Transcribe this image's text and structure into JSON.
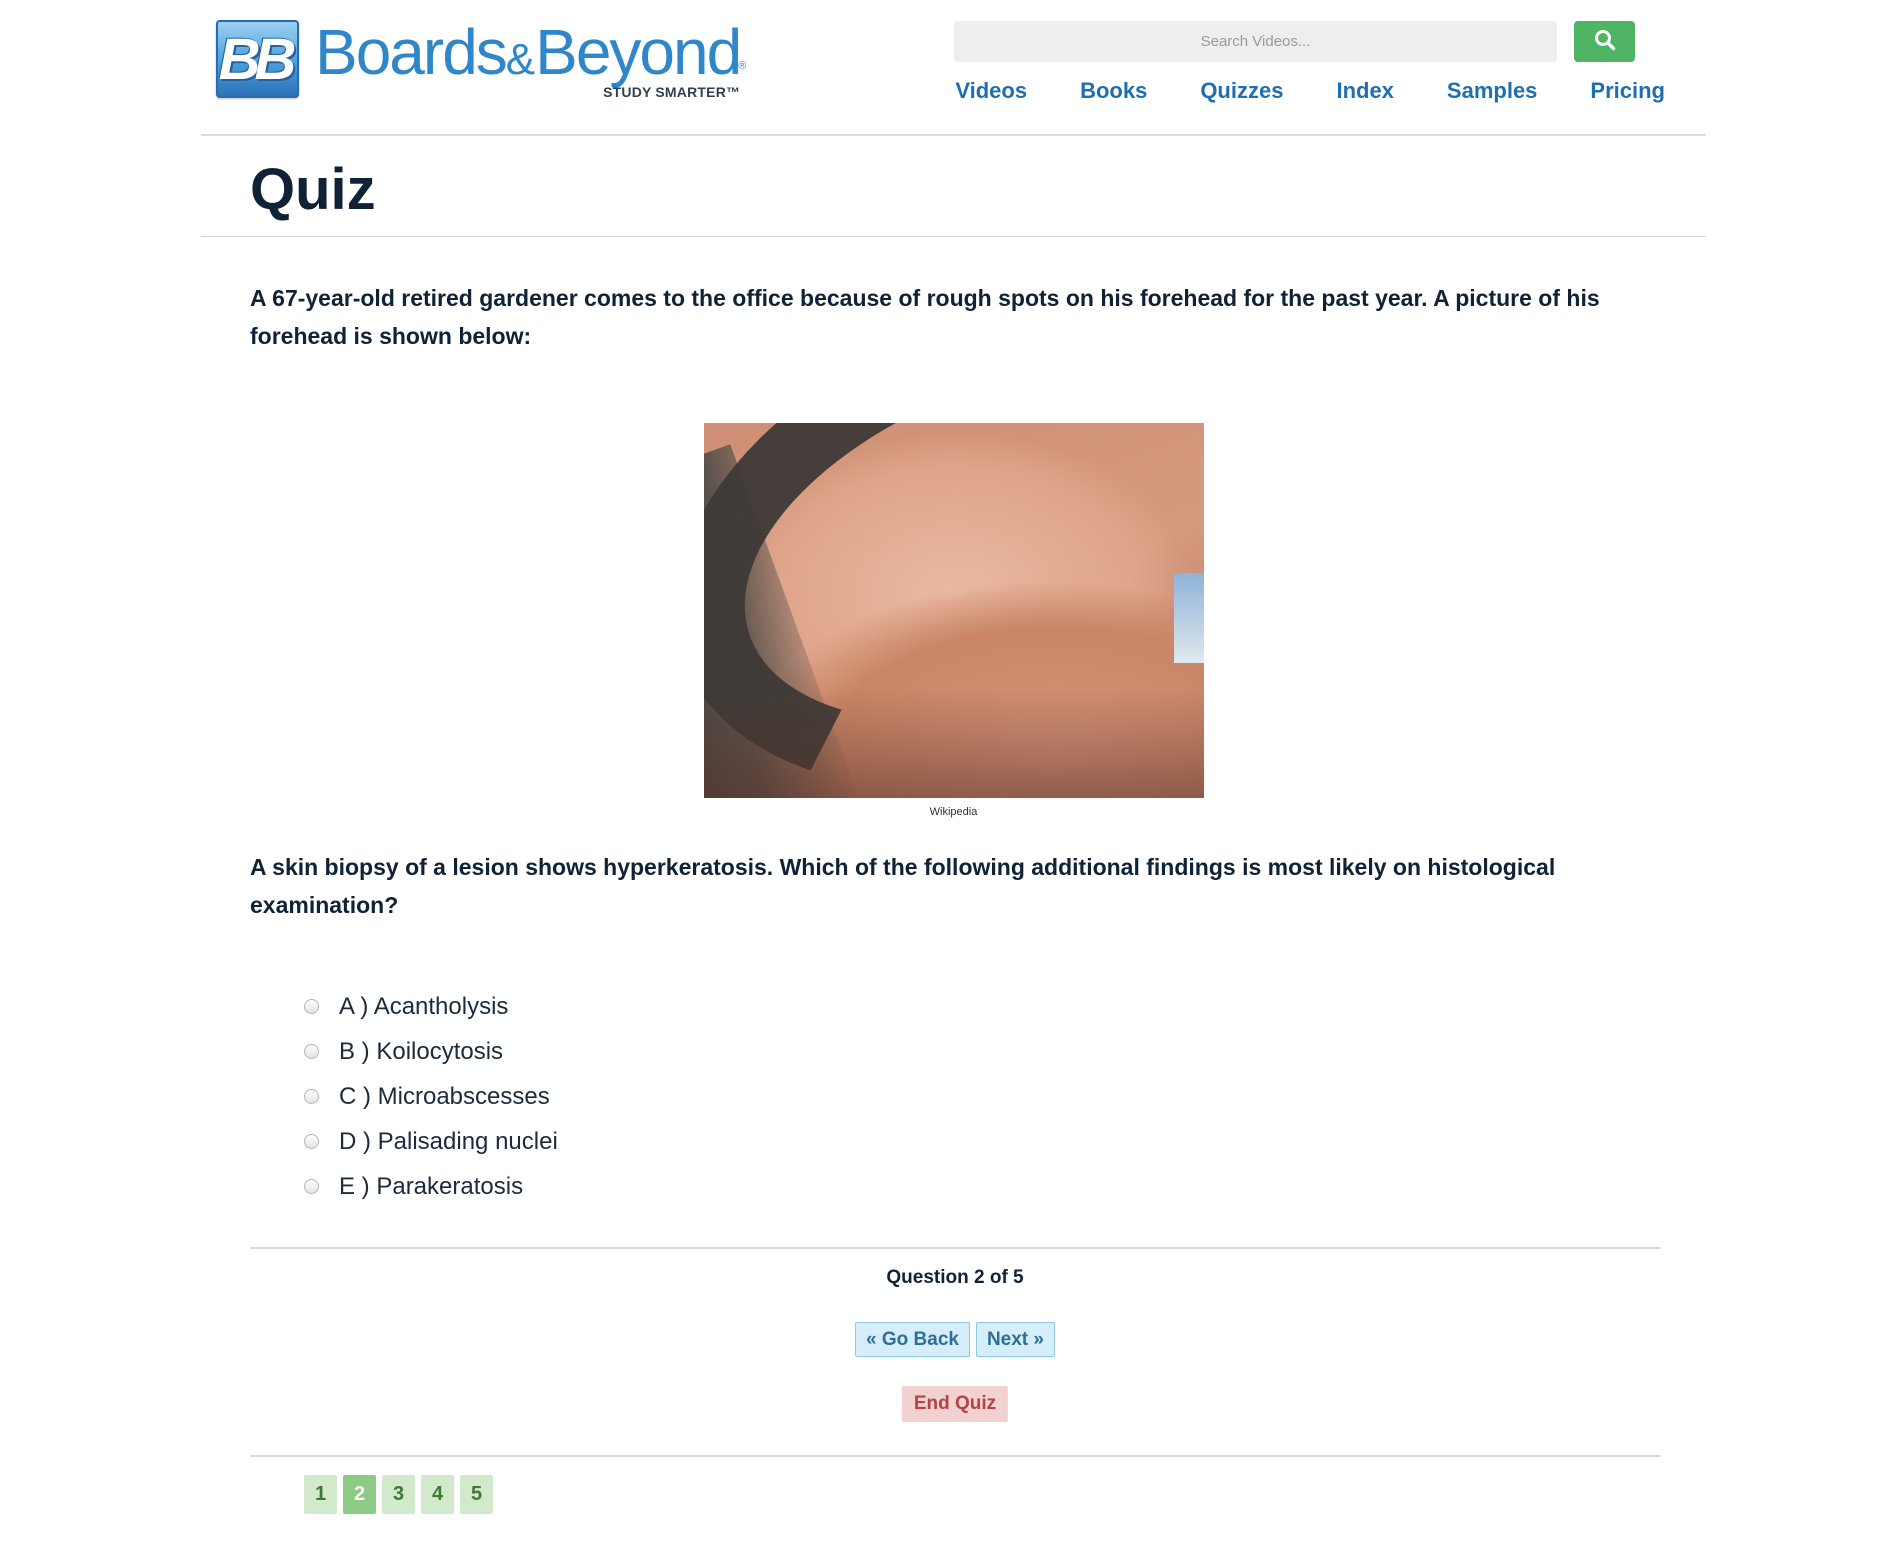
{
  "header": {
    "logo_mark": "BB",
    "logo_word_1": "Boards",
    "logo_amp": "&",
    "logo_word_2": "Beyond",
    "logo_reg": "®",
    "logo_tagline": "STUDY SMARTER™",
    "search": {
      "placeholder": "Search Videos..."
    },
    "nav": [
      "Videos",
      "Books",
      "Quizzes",
      "Index",
      "Samples",
      "Pricing"
    ]
  },
  "page_title": "Quiz",
  "quiz": {
    "stem": "A 67-year-old retired gardener comes to the office because of rough spots on his forehead for the past year. A picture of his forehead is shown below:",
    "image_caption": "Wikipedia",
    "question": "A skin biopsy of a lesion shows hyperkeratosis. Which of the following additional findings is most likely on histological examination?",
    "answers": [
      "A ) Acantholysis",
      "B ) Koilocytosis",
      "C ) Microabscesses",
      "D ) Palisading nuclei",
      "E ) Parakeratosis"
    ],
    "progress_text": "Question 2 of 5",
    "go_back_label": "« Go Back",
    "next_label": "Next »",
    "end_label": "End Quiz",
    "pages": [
      "1",
      "2",
      "3",
      "4",
      "5"
    ],
    "current_page": 2
  },
  "colors": {
    "brand_blue": "#2f86c8",
    "nav_blue": "#1e6fb0",
    "search_green": "#4fb464",
    "end_red": "#b5414b"
  }
}
